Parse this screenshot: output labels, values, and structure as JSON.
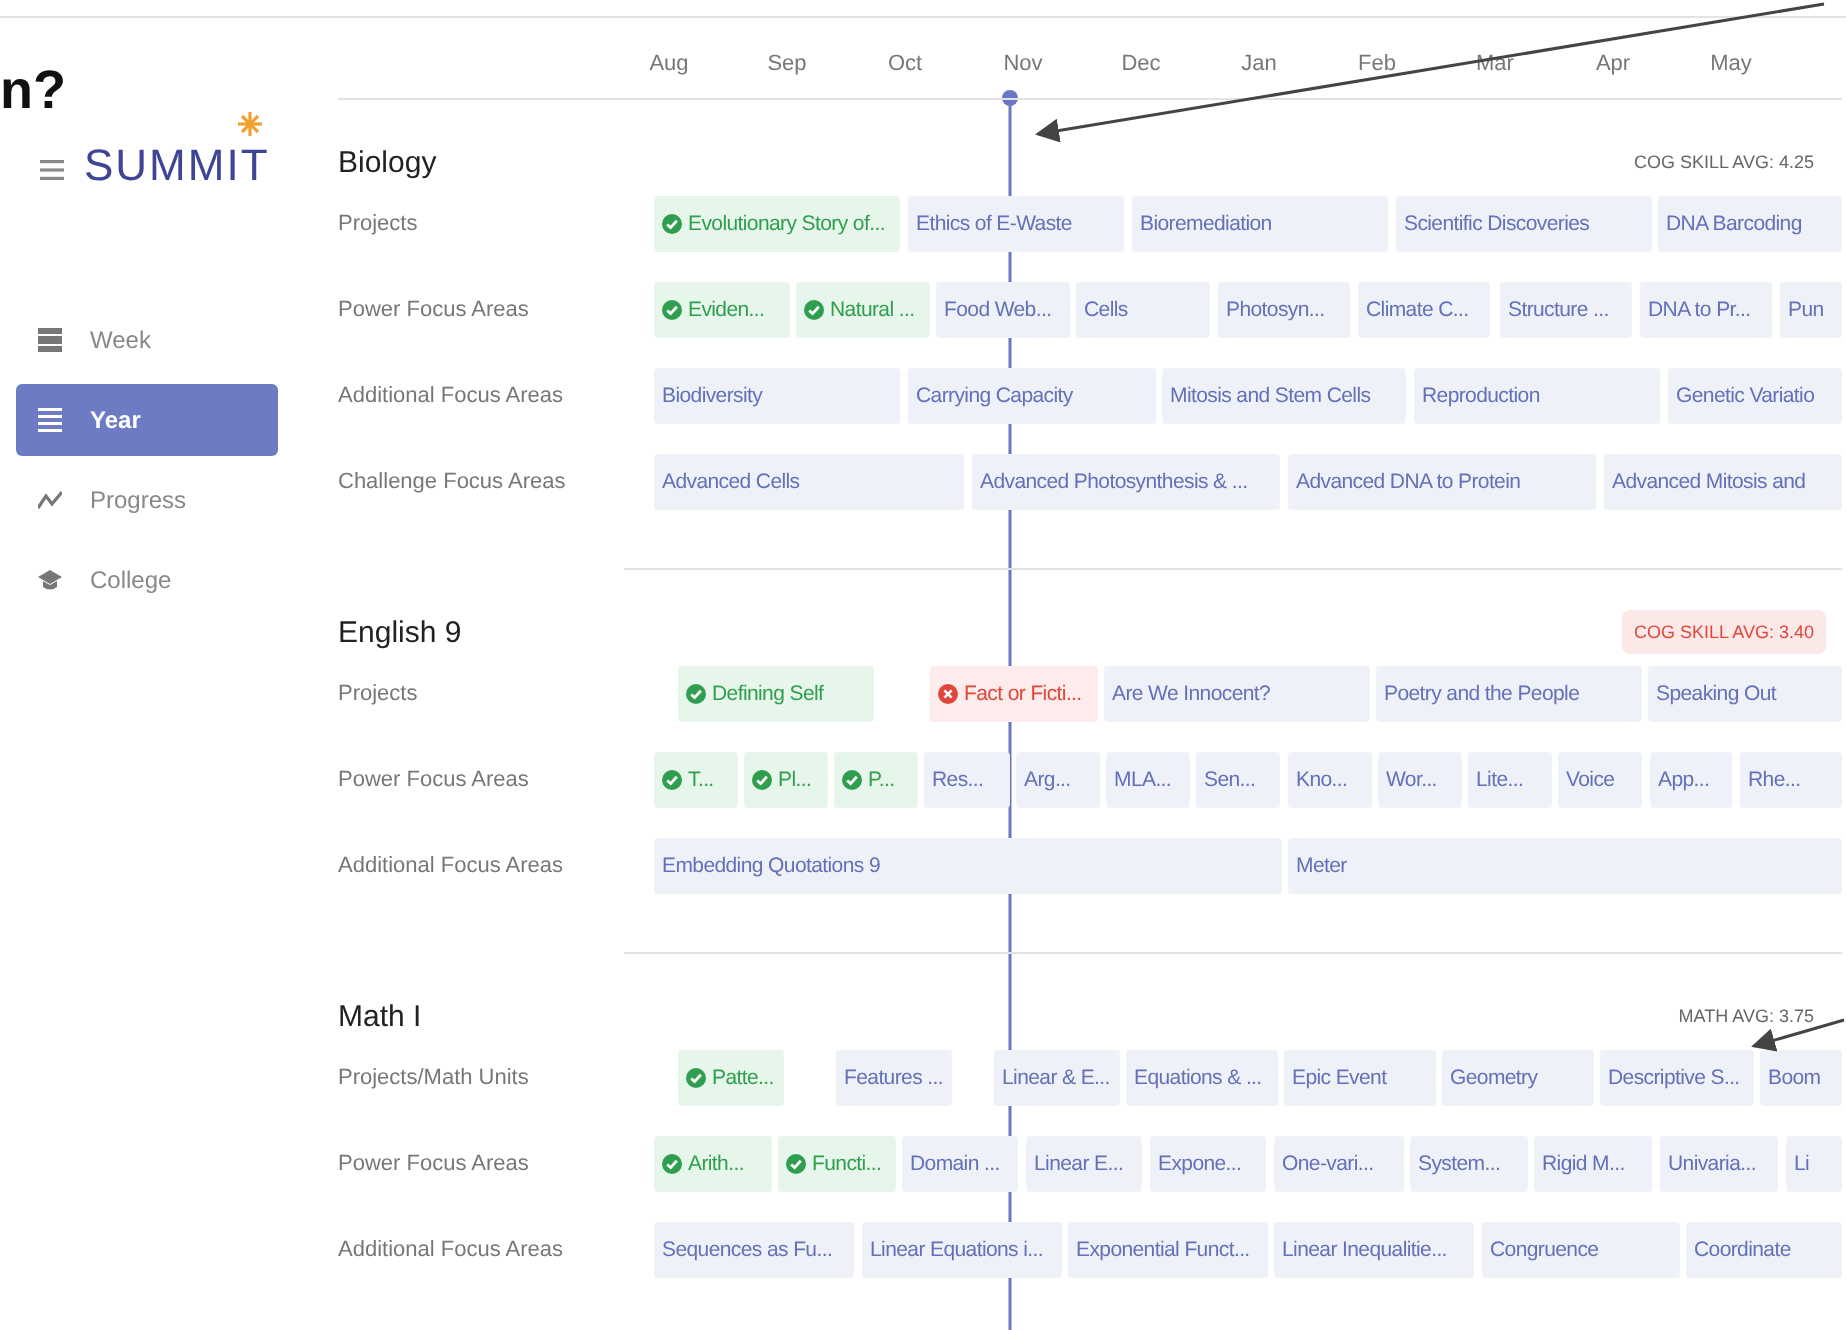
{
  "slide_fragment": "n?",
  "sidebar": {
    "logo": "SUMMIT",
    "items": [
      {
        "label": "Week",
        "selected": false
      },
      {
        "label": "Year",
        "selected": true
      },
      {
        "label": "Progress",
        "selected": false
      },
      {
        "label": "College",
        "selected": false
      }
    ]
  },
  "months": [
    "Aug",
    "Sep",
    "Oct",
    "Nov",
    "Dec",
    "Jan",
    "Feb",
    "Mar",
    "Apr",
    "May"
  ],
  "subjects": [
    {
      "title": "Biology",
      "average": "COG SKILL AVG: 4.25",
      "alert": false,
      "rows": [
        {
          "label": "Projects",
          "items": [
            {
              "text": "Evolutionary Story of...",
              "kind": "done"
            },
            {
              "text": "Ethics of E-Waste",
              "kind": "todo"
            },
            {
              "text": "Bioremediation",
              "kind": "todo"
            },
            {
              "text": "Scientific Discoveries",
              "kind": "todo"
            },
            {
              "text": "DNA Barcoding",
              "kind": "todo"
            }
          ]
        },
        {
          "label": "Power Focus Areas",
          "items": [
            {
              "text": "Eviden...",
              "kind": "done"
            },
            {
              "text": "Natural ...",
              "kind": "done"
            },
            {
              "text": "Food Web...",
              "kind": "todo"
            },
            {
              "text": "Cells",
              "kind": "todo"
            },
            {
              "text": "Photosyn...",
              "kind": "todo"
            },
            {
              "text": "Climate C...",
              "kind": "todo"
            },
            {
              "text": "Structure ...",
              "kind": "todo"
            },
            {
              "text": "DNA to Pr...",
              "kind": "todo"
            },
            {
              "text": "Pun",
              "kind": "todo"
            }
          ]
        },
        {
          "label": "Additional Focus Areas",
          "items": [
            {
              "text": "Biodiversity",
              "kind": "todo"
            },
            {
              "text": "Carrying Capacity",
              "kind": "todo"
            },
            {
              "text": "Mitosis and Stem Cells",
              "kind": "todo"
            },
            {
              "text": "Reproduction",
              "kind": "todo"
            },
            {
              "text": "Genetic Variatio",
              "kind": "todo"
            }
          ]
        },
        {
          "label": "Challenge Focus Areas",
          "items": [
            {
              "text": "Advanced Cells",
              "kind": "todo"
            },
            {
              "text": "Advanced Photosynthesis & ...",
              "kind": "todo"
            },
            {
              "text": "Advanced DNA to Protein",
              "kind": "todo"
            },
            {
              "text": "Advanced Mitosis and",
              "kind": "todo"
            }
          ]
        }
      ]
    },
    {
      "title": "English 9",
      "average": "COG SKILL AVG: 3.40",
      "alert": true,
      "rows": [
        {
          "label": "Projects",
          "items": [
            {
              "text": "Defining Self",
              "kind": "done"
            },
            {
              "text": "Fact or Ficti...",
              "kind": "failed"
            },
            {
              "text": "Are We Innocent?",
              "kind": "todo"
            },
            {
              "text": "Poetry and the People",
              "kind": "todo"
            },
            {
              "text": "Speaking Out",
              "kind": "todo"
            }
          ]
        },
        {
          "label": "Power Focus Areas",
          "items": [
            {
              "text": "T...",
              "kind": "done"
            },
            {
              "text": "Pl...",
              "kind": "done"
            },
            {
              "text": "P...",
              "kind": "done"
            },
            {
              "text": "Res...",
              "kind": "todo"
            },
            {
              "text": "Arg...",
              "kind": "todo"
            },
            {
              "text": "MLA...",
              "kind": "todo"
            },
            {
              "text": "Sen...",
              "kind": "todo"
            },
            {
              "text": "Kno...",
              "kind": "todo"
            },
            {
              "text": "Wor...",
              "kind": "todo"
            },
            {
              "text": "Lite...",
              "kind": "todo"
            },
            {
              "text": "Voice",
              "kind": "todo"
            },
            {
              "text": "App...",
              "kind": "todo"
            },
            {
              "text": "Rhe...",
              "kind": "todo"
            }
          ]
        },
        {
          "label": "Additional Focus Areas",
          "items": [
            {
              "text": "Embedding Quotations 9",
              "kind": "todo"
            },
            {
              "text": "Meter",
              "kind": "todo"
            }
          ]
        }
      ]
    },
    {
      "title": "Math I",
      "average": "MATH AVG: 3.75",
      "alert": false,
      "rows": [
        {
          "label": "Projects/Math Units",
          "items": [
            {
              "text": "Patte...",
              "kind": "done"
            },
            {
              "text": "Features ...",
              "kind": "todo"
            },
            {
              "text": "Linear & E...",
              "kind": "todo"
            },
            {
              "text": "Equations & ...",
              "kind": "todo"
            },
            {
              "text": "Epic Event",
              "kind": "todo"
            },
            {
              "text": "Geometry",
              "kind": "todo"
            },
            {
              "text": "Descriptive S...",
              "kind": "todo"
            },
            {
              "text": "Boom",
              "kind": "todo"
            }
          ]
        },
        {
          "label": "Power Focus Areas",
          "items": [
            {
              "text": "Arith...",
              "kind": "done"
            },
            {
              "text": "Functi...",
              "kind": "done"
            },
            {
              "text": "Domain ...",
              "kind": "todo"
            },
            {
              "text": "Linear E...",
              "kind": "todo"
            },
            {
              "text": "Expone...",
              "kind": "todo"
            },
            {
              "text": "One-vari...",
              "kind": "todo"
            },
            {
              "text": "System...",
              "kind": "todo"
            },
            {
              "text": "Rigid M...",
              "kind": "todo"
            },
            {
              "text": "Univaria...",
              "kind": "todo"
            },
            {
              "text": "Li",
              "kind": "todo"
            }
          ]
        },
        {
          "label": "Additional Focus Areas",
          "items": [
            {
              "text": "Sequences as Fu...",
              "kind": "todo"
            },
            {
              "text": "Linear Equations i...",
              "kind": "todo"
            },
            {
              "text": "Exponential Funct...",
              "kind": "todo"
            },
            {
              "text": "Linear Inequalitie...",
              "kind": "todo"
            },
            {
              "text": "Congruence",
              "kind": "todo"
            },
            {
              "text": "Coordinate",
              "kind": "todo"
            }
          ]
        }
      ]
    }
  ]
}
